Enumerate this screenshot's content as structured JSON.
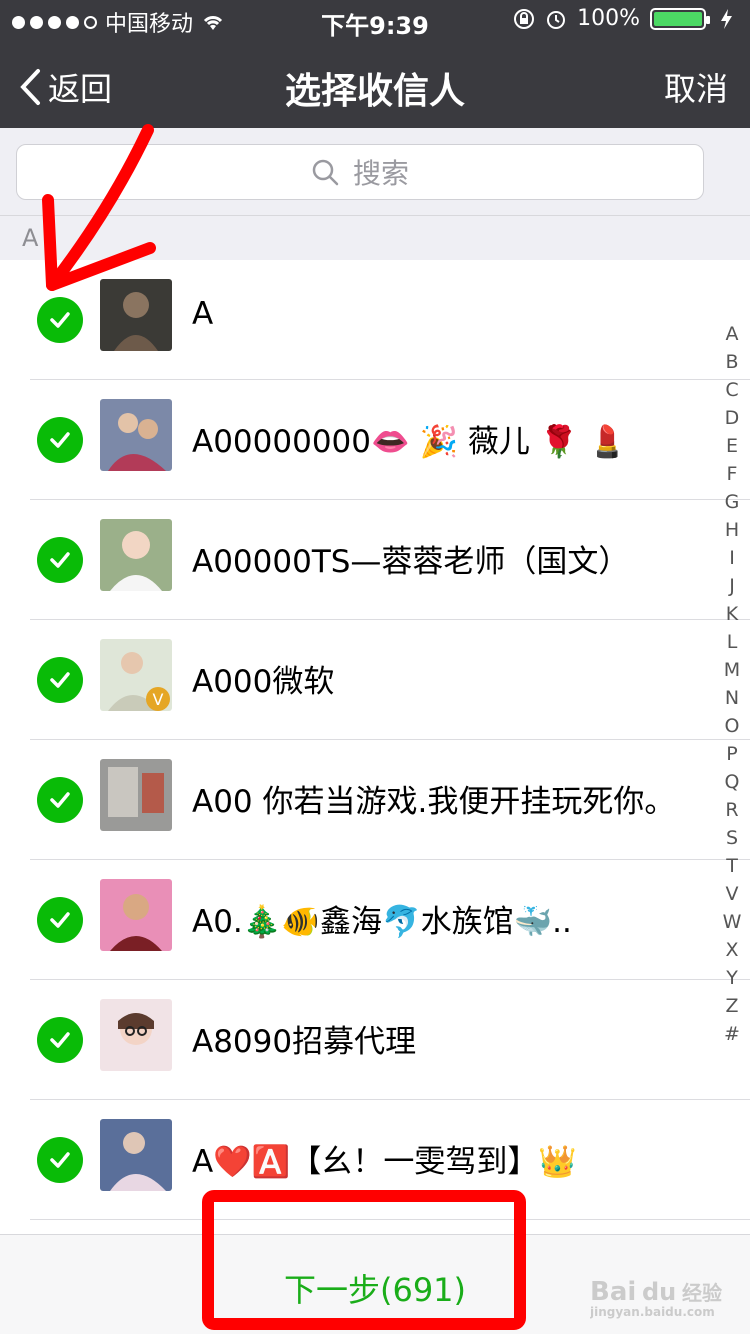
{
  "status": {
    "carrier": "中国移动",
    "time": "下午9:39",
    "battery_text": "100%"
  },
  "nav": {
    "back_label": "返回",
    "title": "选择收信人",
    "cancel_label": "取消"
  },
  "search": {
    "placeholder": "搜索"
  },
  "section": {
    "header": "A"
  },
  "contacts": [
    {
      "name": "A"
    },
    {
      "name": "A00000000👄 🎉 薇儿 🌹 💄"
    },
    {
      "name": "A00000TS—蓉蓉老师（国文）"
    },
    {
      "name": "A000微软"
    },
    {
      "name": "A00 你若当游戏.我便开挂玩死你。"
    },
    {
      "name": "A0.🎄🐠鑫海🐬水族馆🐳.."
    },
    {
      "name": "A8090招募代理"
    },
    {
      "name": "A❤️🅰️【幺！一雯驾到】👑"
    }
  ],
  "index_letters": [
    "A",
    "B",
    "C",
    "D",
    "E",
    "F",
    "G",
    "H",
    "I",
    "J",
    "K",
    "L",
    "M",
    "N",
    "O",
    "P",
    "Q",
    "R",
    "S",
    "T",
    "V",
    "W",
    "X",
    "Y",
    "Z",
    "#"
  ],
  "bottom": {
    "next_label": "下一步(691)"
  },
  "colors": {
    "accent_green": "#09bb07",
    "nav_bg": "#3a3a3f",
    "annotation_red": "#ff0000"
  }
}
